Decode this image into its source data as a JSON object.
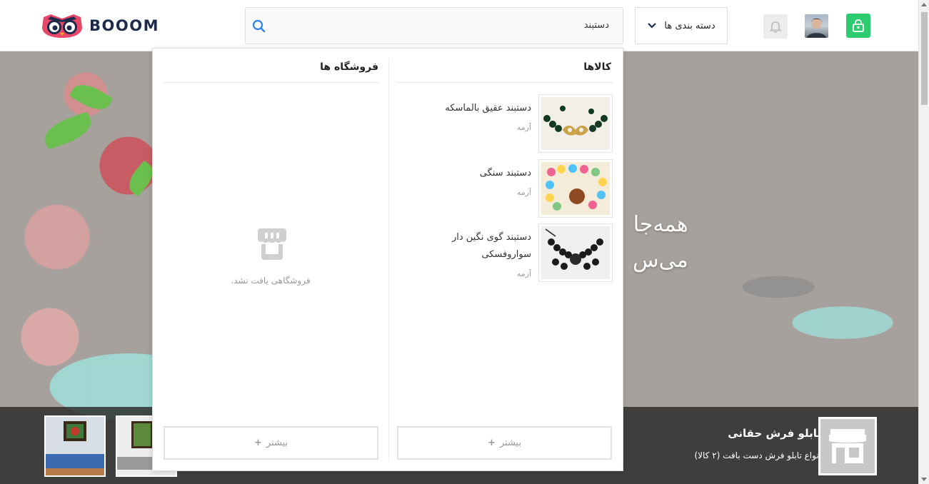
{
  "header": {
    "logo_text": "BOOOM",
    "search": {
      "value": "دستبند"
    },
    "category_label": "دسته بندی ها"
  },
  "hero": {
    "title_line1": "همه‌جا",
    "title_line2": "می‌س"
  },
  "dropdown": {
    "products_heading": "کالاها",
    "stores_heading": "فروشگاه ها",
    "products": [
      {
        "name": "دستبند عقیق بالماسکه",
        "shop": "آرمه"
      },
      {
        "name": "دستبند سنگی",
        "shop": "آرمه"
      },
      {
        "name": "دستبند گوی نگین دار سواروفسکی",
        "shop": "آرمه"
      }
    ],
    "stores_empty_text": "فروشگاهی یافت نشد.",
    "more_label": "بیشتر",
    "more_icon": "+"
  },
  "strip": {
    "store_name": "تابلو فرش حقانی",
    "store_desc": "انواع تابلو فرش دست بافت  (۲ کالا)"
  },
  "colors": {
    "accent_green": "#2ecc71",
    "search_icon_blue": "#2f80ed",
    "logo_navy": "#1d2b4a",
    "logo_pink": "#e8476a"
  }
}
